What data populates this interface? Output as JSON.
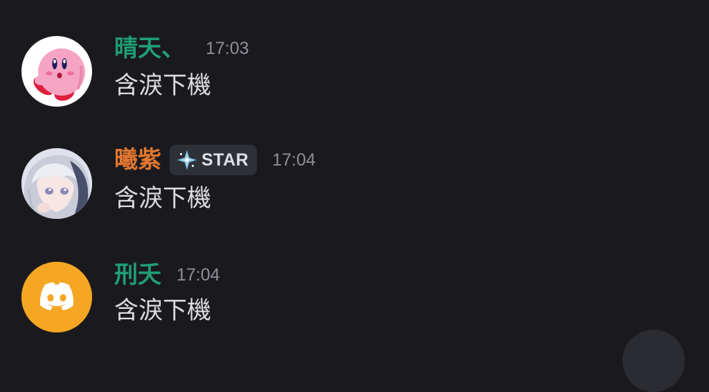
{
  "messages": [
    {
      "username": "晴天、",
      "username_color": "#1f9e74",
      "timestamp": "17:03",
      "content": "含淚下機",
      "avatar": "kirby-avatar"
    },
    {
      "username": "曦紫",
      "username_color": "#e0762f",
      "badge": {
        "icon": "star-sparkle-icon",
        "label": "STAR"
      },
      "timestamp": "17:04",
      "content": "含淚下機",
      "avatar": "anime-girl-avatar"
    },
    {
      "username": "刑夭",
      "username_color": "#1f9e74",
      "timestamp": "17:04",
      "content": "含淚下機",
      "avatar": "discord-default-avatar",
      "avatar_color": "#f5a623"
    }
  ],
  "colors": {
    "background": "#1a1a1e",
    "timestamp": "#8e9099",
    "message_text": "#dcdde1",
    "badge_bg": "#2e3038"
  }
}
